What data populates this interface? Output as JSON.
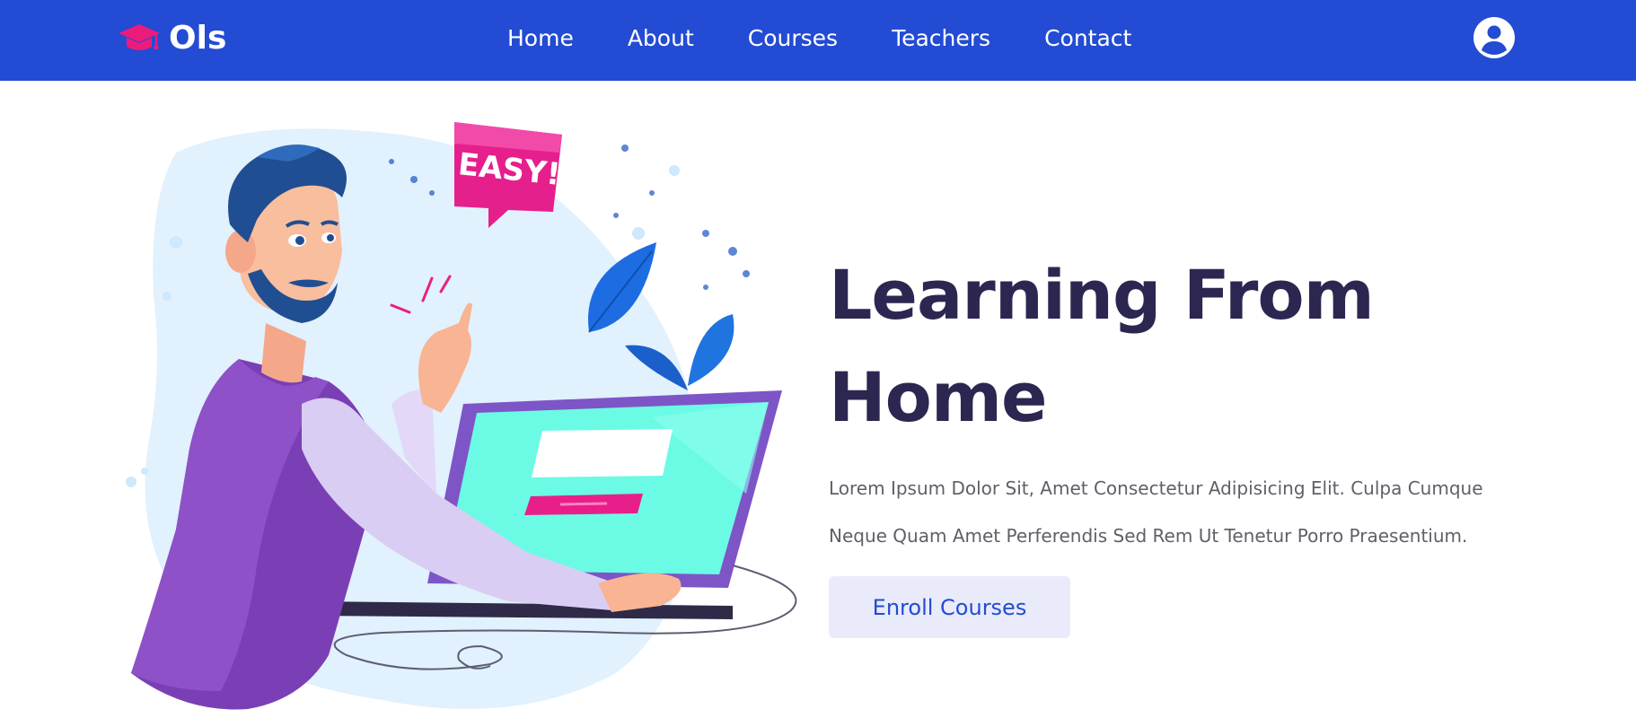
{
  "header": {
    "logo_text": "Ols",
    "logo_icon": "graduation-cap-icon",
    "nav": [
      {
        "label": "Home"
      },
      {
        "label": "About"
      },
      {
        "label": "Courses"
      },
      {
        "label": "Teachers"
      },
      {
        "label": "Contact"
      }
    ],
    "account_icon": "user-circle-icon"
  },
  "hero": {
    "title_line1": "Learning From",
    "title_line2": "Home",
    "description": "Lorem Ipsum Dolor Sit, Amet Consectetur Adipisicing Elit. Culpa Cumque Neque Quam Amet Perferendis Sed Rem Ut Tenetur Porro Praesentium.",
    "button_label": "Enroll Courses",
    "illustration": {
      "bubble_text": "EASY!"
    }
  },
  "colors": {
    "brand": "#234bd3",
    "accent": "#ec1b7b",
    "title": "#2b2750",
    "button_bg": "#e9ebfa"
  }
}
